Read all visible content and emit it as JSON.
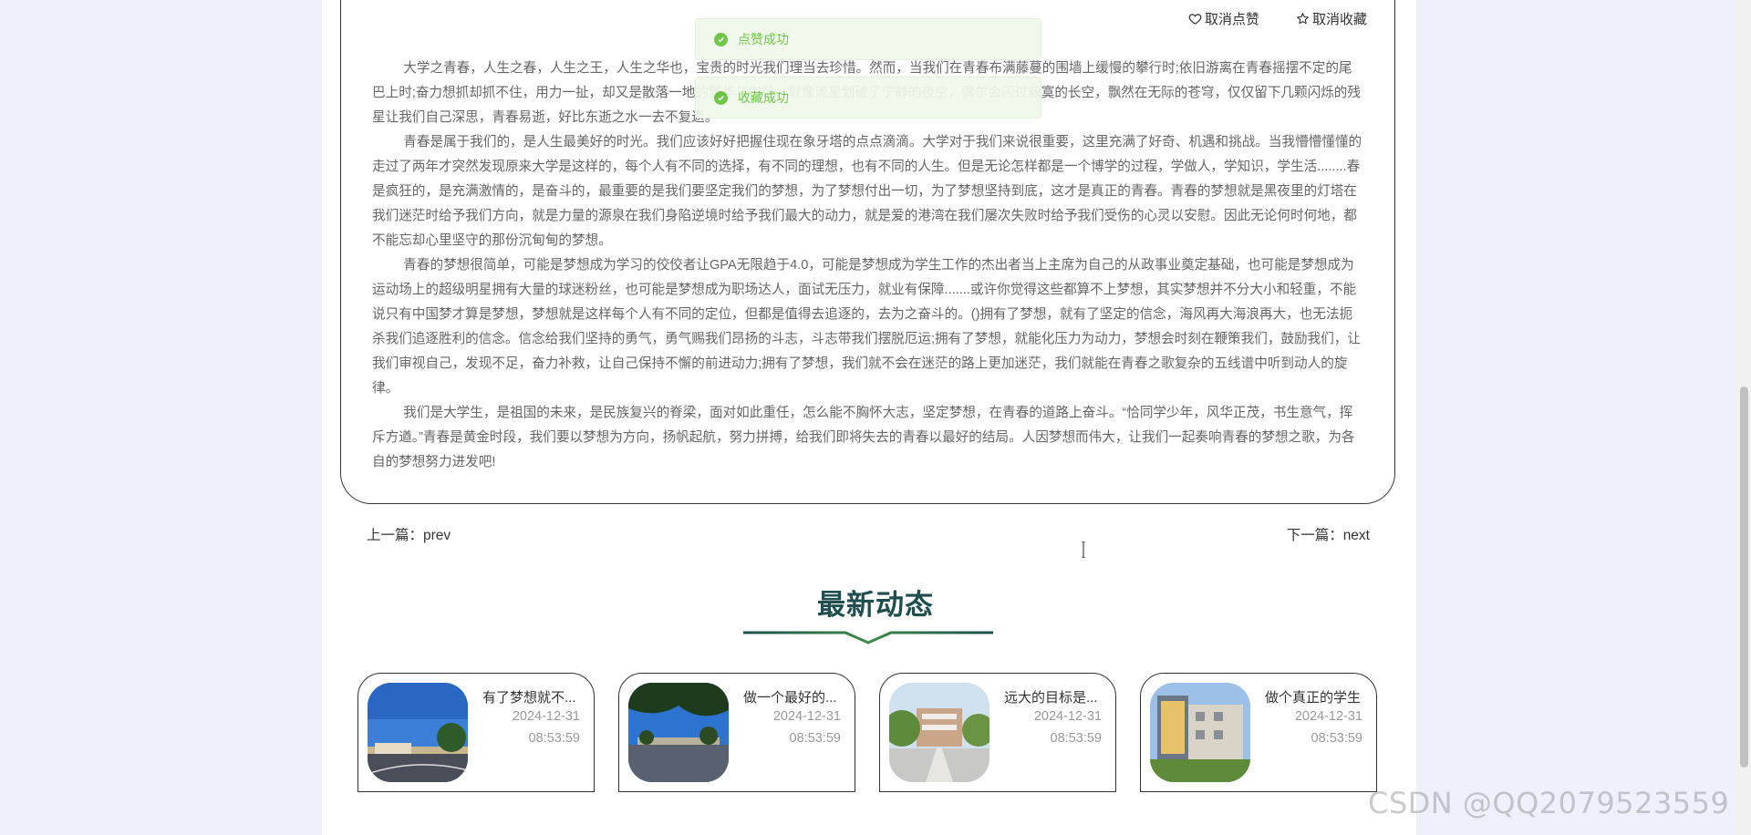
{
  "actions": {
    "unlike_label": "取消点赞",
    "unfavorite_label": "取消收藏"
  },
  "toasts": [
    {
      "message": "点赞成功"
    },
    {
      "message": "收藏成功"
    }
  ],
  "article": {
    "paragraphs": [
      "大学之青春，人生之春，人生之王，人生之华也，宝贵的时光我们理当去珍惜。然而，当我们在青春布满藤蔓的围墙上缓慢的攀行时;依旧游离在青春摇摆不定的尾巴上时;奋力想抓却抓不住，用力一扯，却又是散落一地的繁华与失落，就像流星划破了宁静的夜空，偶尔会闪过寂寞的长空，飘然在无际的苍穹，仅仅留下几颗闪烁的残星让我们自己深思，青春易逝，好比东逝之水一去不复返。",
      "青春是属于我们的，是人生最美好的时光。我们应该好好把握住现在象牙塔的点点滴滴。大学对于我们来说很重要，这里充满了好奇、机遇和挑战。当我懵懵懂懂的走过了两年才突然发现原来大学是这样的，每个人有不同的选择，有不同的理想，也有不同的人生。但是无论怎样都是一个博学的过程，学做人，学知识，学生活........春是疯狂的，是充满激情的，是奋斗的，最重要的是我们要坚定我们的梦想，为了梦想付出一切，为了梦想坚持到底，这才是真正的青春。青春的梦想就是黑夜里的灯塔在我们迷茫时给予我们方向，就是力量的源泉在我们身陷逆境时给予我们最大的动力，就是爱的港湾在我们屡次失败时给予我们受伤的心灵以安慰。因此无论何时何地，都不能忘却心里坚守的那份沉甸甸的梦想。",
      "青春的梦想很简单，可能是梦想成为学习的佼佼者让GPA无限趋于4.0，可能是梦想成为学生工作的杰出者当上主席为自己的从政事业奠定基础，也可能是梦想成为运动场上的超级明星拥有大量的球迷粉丝，也可能是梦想成为职场达人，面试无压力，就业有保障.......或许你觉得这些都算不上梦想，其实梦想并不分大小和轻重，不能说只有中国梦才算是梦想，梦想就是这样每个人有不同的定位，但都是值得去追逐的，去为之奋斗的。()拥有了梦想，就有了坚定的信念，海风再大海浪再大，也无法扼杀我们追逐胜利的信念。信念给我们坚持的勇气，勇气赐我们昂扬的斗志，斗志带我们摆脱厄运;拥有了梦想，就能化压力为动力，梦想会时刻在鞭策我们，鼓励我们，让我们审视自己，发现不足，奋力补救，让自己保持不懈的前进动力;拥有了梦想，我们就不会在迷茫的路上更加迷茫，我们就能在青春之歌复杂的五线谱中听到动人的旋律。",
      "我们是大学生，是祖国的未来，是民族复兴的脊梁，面对如此重任，怎么能不胸怀大志，坚定梦想，在青春的道路上奋斗。“恰同学少年，风华正茂，书生意气，挥斥方遒。”青春是黄金时段，我们要以梦想为方向，扬帆起航，努力拼搏，给我们即将失去的青春以最好的结局。人因梦想而伟大，让我们一起奏响青春的梦想之歌，为各自的梦想努力进发吧!"
    ]
  },
  "nav": {
    "prev": "上一篇：prev",
    "next": "下一篇：next"
  },
  "latest": {
    "title": "最新动态",
    "cards": [
      {
        "title": "有了梦想就不...",
        "date": "2024-12-31",
        "time": "08:53:59",
        "image": "campus-track-photo"
      },
      {
        "title": "做一个最好的...",
        "date": "2024-12-31",
        "time": "08:53:59",
        "image": "campus-square-photo"
      },
      {
        "title": "远大的目标是...",
        "date": "2024-12-31",
        "time": "08:53:59",
        "image": "campus-building-photo"
      },
      {
        "title": "做个真正的学生",
        "date": "2024-12-31",
        "time": "08:53:59",
        "image": "campus-dorm-photo"
      }
    ]
  },
  "watermark": "CSDN @QQ2079523559",
  "colors": {
    "accent": "#1f4e4e",
    "success": "#67c23a",
    "page_bg": "#eef0fb"
  }
}
